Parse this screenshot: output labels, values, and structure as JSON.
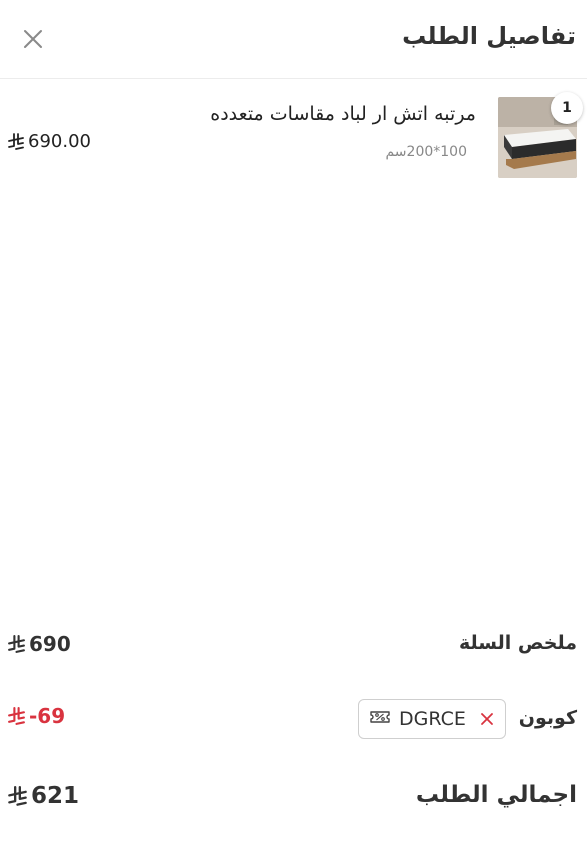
{
  "header": {
    "title": "تفاصيل الطلب",
    "close_icon": "close-icon"
  },
  "item": {
    "quantity": "1",
    "name": "مرتبه اتش ار لباد مقاسات متعدده",
    "variant": "100*200سم",
    "price": "690.00",
    "currency_icon": "saudi-riyal-icon"
  },
  "summary": {
    "subtotal_label": "ملخص السلة",
    "subtotal_value": "690",
    "coupon_label": "كوبون",
    "coupon_code": "DGRCE",
    "coupon_discount": "-69",
    "total_label": "اجمالي الطلب",
    "total_value": "621"
  },
  "colors": {
    "discount": "#d9333f",
    "remove_icon": "#d9333f",
    "text": "#333333",
    "muted": "#888888"
  }
}
